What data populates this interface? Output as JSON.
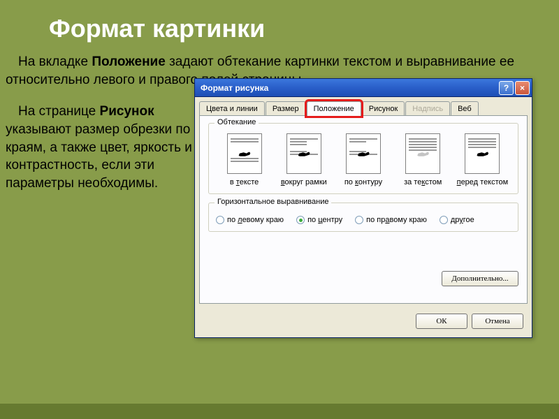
{
  "slide": {
    "title": "Формат картинки",
    "para1_prefix": "На вкладке ",
    "para1_bold": "Положение",
    "para1_suffix": " задают обтекание картинки текстом и выравнивание ее относительно левого и правого полей страницы.",
    "para2_prefix": "На странице ",
    "para2_bold": "Рисунок",
    "para2_suffix": " указывают размер обрезки по краям, а также цвет, яркость и контрастность, если эти параметры необходимы."
  },
  "dialog": {
    "title": "Формат рисунка",
    "tabs": {
      "colors": "Цвета и линии",
      "size": "Размер",
      "position": "Положение",
      "picture": "Рисунок",
      "caption": "Надпись",
      "web": "Веб"
    },
    "groups": {
      "wrapping": "Обтекание",
      "alignment": "Горизонтальное выравнивание"
    },
    "wrap_options": [
      {
        "key": "inline",
        "label_pre": "в ",
        "label_u": "т",
        "label_post": "ексте"
      },
      {
        "key": "square",
        "label_pre": "",
        "label_u": "в",
        "label_post": "округ рамки"
      },
      {
        "key": "tight",
        "label_pre": "по ",
        "label_u": "к",
        "label_post": "онтуру"
      },
      {
        "key": "behind",
        "label_pre": "за те",
        "label_u": "к",
        "label_post": "стом"
      },
      {
        "key": "front",
        "label_pre": "",
        "label_u": "п",
        "label_post": "еред текстом"
      }
    ],
    "align_options": {
      "left": {
        "pre": "по ",
        "u": "л",
        "post": "евому краю"
      },
      "center": {
        "pre": "по ",
        "u": "ц",
        "post": "ентру"
      },
      "right": {
        "pre": "по пр",
        "u": "а",
        "post": "вому краю"
      },
      "other": {
        "pre": "др",
        "u": "у",
        "post": "гое"
      }
    },
    "align_selected": "center",
    "buttons": {
      "advanced": "Дополнительно...",
      "ok": "ОК",
      "cancel": "Отмена"
    }
  }
}
